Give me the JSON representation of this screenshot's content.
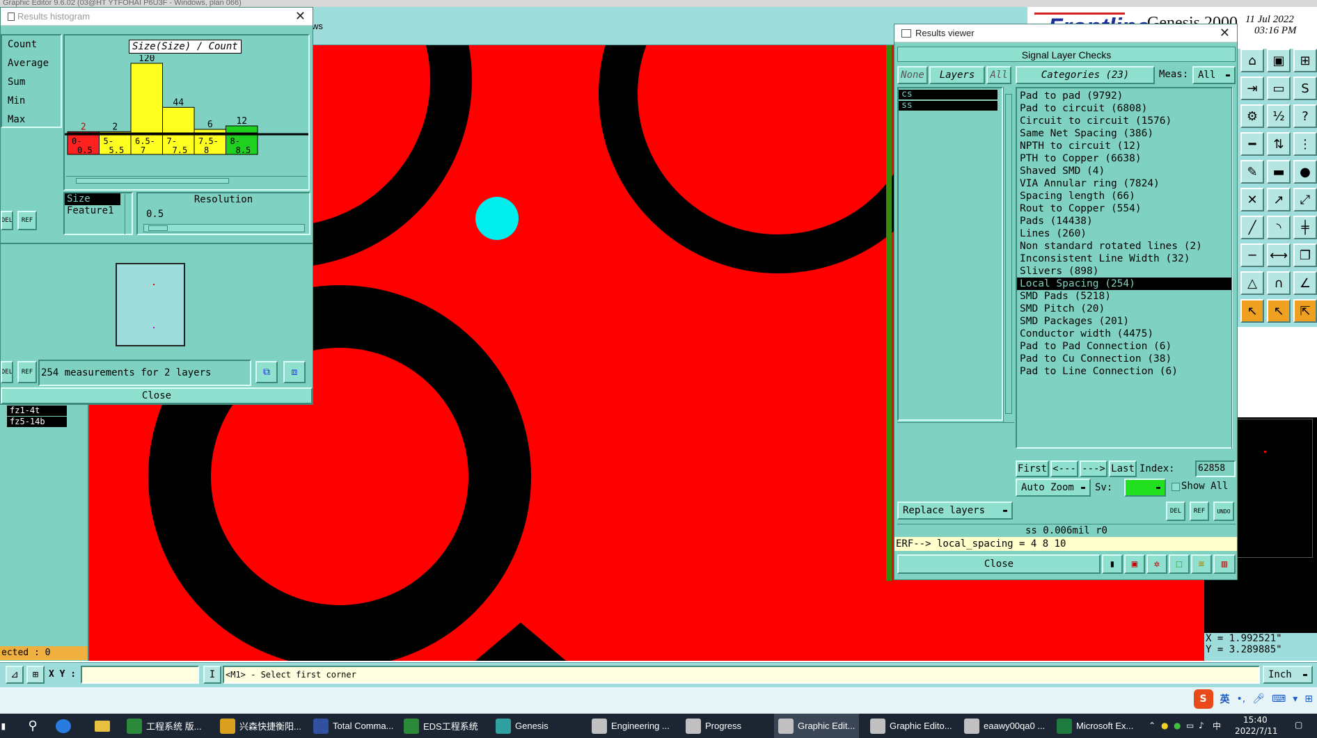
{
  "app": {
    "title_partial": "Graphic Editor 9.6.02 (03@HT YTFOHAI P6U3F - Windows, plan 066)",
    "menu_partial": "ws"
  },
  "header": {
    "brand": "Frontline",
    "product": "Genesis 2000",
    "date": "11 Jul 2022",
    "time": "03:16 PM"
  },
  "histogram": {
    "window_title": "Results histogram",
    "stats": [
      "Count",
      "Average",
      "Sum",
      "Min",
      "Max"
    ],
    "chart_title": "Size(Size) / Count",
    "feature_list": [
      "Size",
      "Feature1"
    ],
    "resolution_label": "Resolution",
    "resolution_value": "0.5",
    "measurements": "254 measurements for 2 layers",
    "close_label": "Close",
    "del_label": "DEL",
    "ref_label": "REF"
  },
  "chart_data": {
    "type": "bar",
    "title": "Size(Size) / Count",
    "categories": [
      "0-0.5",
      "5-5.5",
      "6.5-7",
      "7-7.5",
      "7.5-8",
      "8-8.5"
    ],
    "values": [
      2,
      2,
      120,
      44,
      6,
      12
    ],
    "colors": [
      "#ff2020",
      "#ffff20",
      "#ffff20",
      "#ffff20",
      "#ffff20",
      "#20d020"
    ],
    "ylim": [
      0,
      120
    ]
  },
  "left_panel": {
    "layers": [
      "fz1-4t",
      "fz5-14b"
    ],
    "selected_text": "ected : 0"
  },
  "viewer": {
    "window_title": "Results viewer",
    "header": "Signal Layer Checks",
    "none_label": "None",
    "layers_label": "Layers",
    "all_label": "All",
    "categories_label": "Categories (23)",
    "meas_label": "Meas:",
    "meas_value": "All",
    "layer_list": [
      "cs",
      "ss"
    ],
    "categories": [
      "Pad to pad (9792)",
      "Pad to circuit (6808)",
      "Circuit to circuit (1576)",
      "Same Net Spacing (386)",
      "NPTH to circuit (12)",
      "PTH to Copper (6638)",
      "Shaved SMD (4)",
      "VIA Annular ring (7824)",
      "Spacing length (66)",
      "Rout to Copper (554)",
      "Pads (14438)",
      "Lines (260)",
      "Non standard rotated lines (2)",
      "Inconsistent Line Width (32)",
      "Slivers (898)",
      "Local Spacing (254)",
      "SMD Pads (5218)",
      "SMD Pitch (20)",
      "SMD Packages (201)",
      "Conductor width (4475)",
      "Pad to Pad Connection (6)",
      "Pad to Cu Connection (38)",
      "Pad to Line Connection (6)"
    ],
    "selected_index": 15,
    "first": "First",
    "prev": "<---",
    "next": "--->",
    "last": "Last",
    "index_label": "Index:",
    "index_value": "62858",
    "auto_zoom": "Auto Zoom",
    "sv_label": "Sv:",
    "show_all": "Show All",
    "replace_layers": "Replace layers",
    "del": "DEL",
    "ref": "REF",
    "undo": "UNDO",
    "status": "ss 0.006mil  r0",
    "erf": "ERF--> local_spacing = 4 8 10",
    "close": "Close"
  },
  "coords": {
    "x": "X = 1.992521\"",
    "y": "Y = 3.289885\""
  },
  "bottom_bar": {
    "xy_label": "X Y :",
    "xy_value": "",
    "prompt": "<M1> - Select first corner",
    "units": "Inch"
  },
  "tray": {
    "ime": "英",
    "time": "15:40",
    "date": "2022/7/11",
    "ime2": "中"
  },
  "taskbar": [
    {
      "label": "工程系统  版...",
      "color": "#2a8a3a"
    },
    {
      "label": "兴森快捷衡阳...",
      "color": "#d9a020"
    },
    {
      "label": "Total Comma...",
      "color": "#3050a0"
    },
    {
      "label": "EDS工程系统",
      "color": "#2a8a3a"
    },
    {
      "label": "Genesis",
      "color": "#30a0a0"
    },
    {
      "label": "Engineering ...",
      "color": "#c0c0c0"
    },
    {
      "label": "Progress",
      "color": "#c0c0c0"
    },
    {
      "label": "Graphic Edit...",
      "color": "#c0c0c0"
    },
    {
      "label": "Graphic Edito...",
      "color": "#c0c0c0"
    },
    {
      "label": "eaawy00qa0 ...",
      "color": "#c0c0c0"
    },
    {
      "label": "Microsoft Ex...",
      "color": "#1f7a3f"
    }
  ]
}
